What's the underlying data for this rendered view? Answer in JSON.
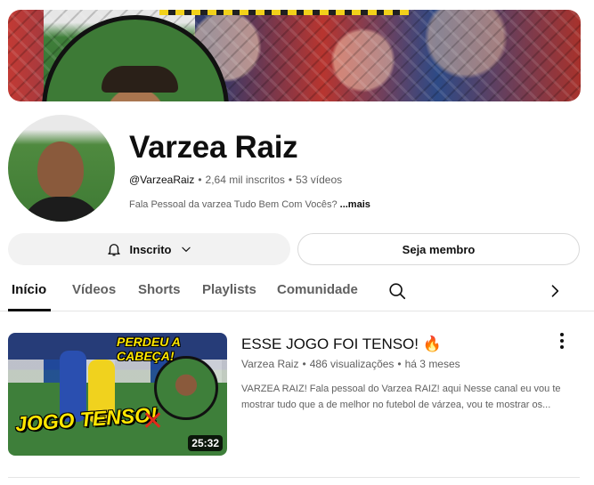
{
  "channel": {
    "name": "Varzea Raiz",
    "handle": "@VarzeaRaiz",
    "subscribers": "2,64 mil inscritos",
    "videos_count": "53 vídeos",
    "description": "Fala Pessoal da varzea Tudo Bem Com Vocês?",
    "more_label": "...mais"
  },
  "actions": {
    "subscribed_label": "Inscrito",
    "member_label": "Seja membro"
  },
  "tabs": [
    {
      "label": "Início",
      "active": true
    },
    {
      "label": "Vídeos",
      "active": false
    },
    {
      "label": "Shorts",
      "active": false
    },
    {
      "label": "Playlists",
      "active": false
    },
    {
      "label": "Comunidade",
      "active": false
    }
  ],
  "icons": {
    "bell": "bell-icon",
    "chevron_down": "chevron-down-icon",
    "search": "search-icon",
    "chevron_right": "chevron-right-icon",
    "more": "more-vert-icon"
  },
  "featured_video": {
    "title": "ESSE JOGO FOI TENSO! 🔥",
    "channel": "Varzea Raiz",
    "views": "486 visualizações",
    "age": "há 3 meses",
    "description": "VARZEA RAIZ! Fala pessoal do Varzea RAIZ! aqui Nesse canal eu vou te mostrar tudo que a de melhor no futebol de várzea, vou te mostrar os...",
    "duration": "25:32",
    "thumb_top_text": "PERDEU A CABEÇA!",
    "thumb_main_text": "JOGO TENSO!",
    "thumb_mark": "✕"
  },
  "colors": {
    "text_primary": "#0f0f0f",
    "text_secondary": "#606060",
    "button_bg": "#f2f2f2",
    "thumb_yellow": "#ffe700"
  }
}
